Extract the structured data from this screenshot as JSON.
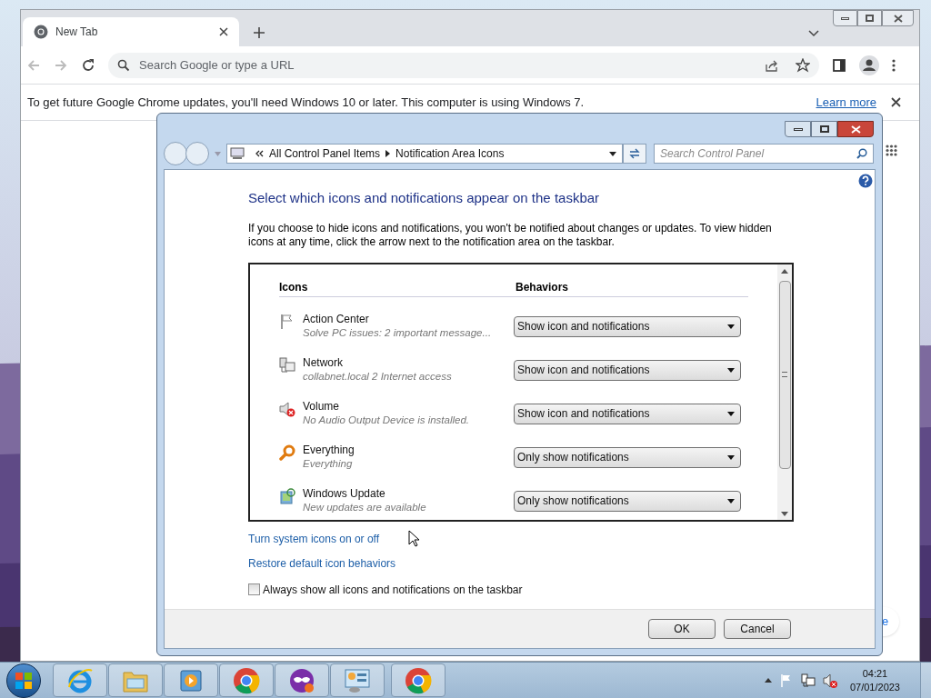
{
  "browser": {
    "tab": {
      "title": "New Tab"
    },
    "address": {
      "placeholder": "Search Google or type a URL"
    },
    "infobar": {
      "message": "To get future Google Chrome updates, you'll need Windows 10 or later. This computer is using Windows 7.",
      "link": "Learn more"
    },
    "page": {
      "button_fragment": "e"
    }
  },
  "dialog": {
    "breadcrumb": [
      "All Control Panel Items",
      "Notification Area Icons"
    ],
    "search": {
      "placeholder": "Search Control Panel"
    },
    "heading": "Select which icons and notifications appear on the taskbar",
    "description": "If you choose to hide icons and notifications, you won't be notified about changes or updates. To view hidden icons at any time, click the arrow next to the notification area on the taskbar.",
    "columns": [
      "Icons",
      "Behaviors"
    ],
    "rows": [
      {
        "kind": "flag",
        "name": "Action Center",
        "detail": "Solve PC issues: 2 important message...",
        "behavior": "Show icon and notifications"
      },
      {
        "kind": "network",
        "name": "Network",
        "detail": "collabnet.local  2 Internet access",
        "behavior": "Show icon and notifications"
      },
      {
        "kind": "volume",
        "name": "Volume",
        "detail": "No Audio Output Device is installed.",
        "behavior": "Show icon and notifications"
      },
      {
        "kind": "search",
        "name": "Everything",
        "detail": "Everything",
        "behavior": "Only show notifications"
      },
      {
        "kind": "update",
        "name": "Windows Update",
        "detail": "New updates are available",
        "behavior": "Only show notifications"
      }
    ],
    "links": [
      "Turn system icons on or off",
      "Restore default icon behaviors"
    ],
    "checkbox": {
      "label": "Always show all icons and notifications on the taskbar",
      "checked": false
    },
    "buttons": [
      "OK",
      "Cancel"
    ]
  },
  "taskbar": {
    "apps": [
      {
        "kind": "ie"
      },
      {
        "kind": "folder"
      },
      {
        "kind": "media"
      },
      {
        "kind": "chrome"
      },
      {
        "kind": "mask"
      },
      {
        "kind": "panel"
      },
      {
        "kind": "chrome"
      }
    ],
    "tray": [
      {
        "kind": "flag"
      },
      {
        "kind": "network"
      },
      {
        "kind": "volume"
      }
    ],
    "time": "04:21",
    "date": "07/01/2023"
  }
}
